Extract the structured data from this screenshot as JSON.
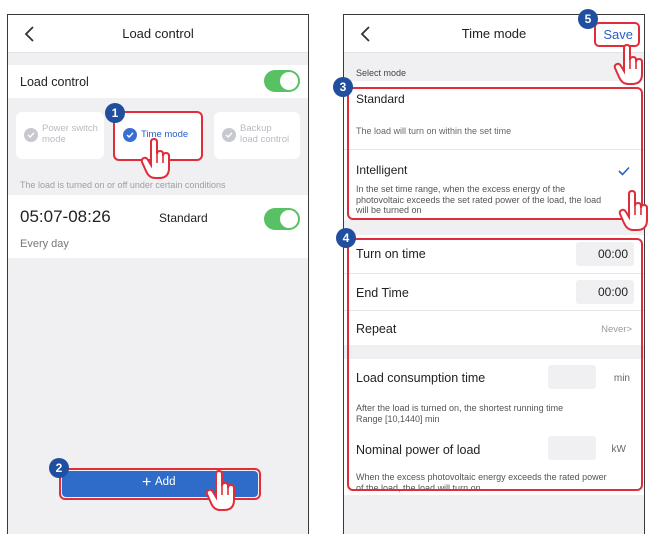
{
  "left": {
    "title": "Load control",
    "load_control_label": "Load control",
    "modes": [
      "Power switch mode",
      "Time mode",
      "Backup load control"
    ],
    "mode_lines": [
      [
        "Power switch",
        "mode"
      ],
      [
        "Time mode"
      ],
      [
        "Backup",
        "load control"
      ]
    ],
    "selected_mode": "Time mode",
    "hint": "The load is turned on or off under certain conditions",
    "schedule": {
      "time": "05:07-08:26",
      "mode": "Standard",
      "repeat": "Every day"
    },
    "add_label": "Add"
  },
  "right": {
    "title": "Time mode",
    "save_label": "Save",
    "select_mode_label": "Select mode",
    "standard": {
      "label": "Standard",
      "desc": "The load will turn on within the set time"
    },
    "intelligent": {
      "label": "Intelligent",
      "desc_lines": [
        "In the set time range, when the excess energy of the",
        "photovoltaic exceeds the set rated power of the load, the load",
        "will be turned on"
      ]
    },
    "turn_on_time": {
      "label": "Turn on time",
      "value": "00:00"
    },
    "end_time": {
      "label": "End Time",
      "value": "00:00"
    },
    "repeat": {
      "label": "Repeat",
      "value": "Never>"
    },
    "consumption": {
      "label": "Load consumption time",
      "unit": "min",
      "desc_lines": [
        "After the load is turned on, the shortest running time",
        "Range [10,1440] min"
      ]
    },
    "nominal": {
      "label": "Nominal  power of  load",
      "unit": "kW",
      "desc_lines": [
        "When the excess photovoltaic energy exceeds the rated power",
        "of the load, the load will turn on"
      ]
    }
  },
  "badges": [
    "1",
    "2",
    "3",
    "4",
    "5"
  ],
  "colors": {
    "accent_blue": "#3a6fd2",
    "toggle_green": "#57c163",
    "highlight_red": "#e02d3a",
    "badge_blue": "#1f4f9e"
  }
}
